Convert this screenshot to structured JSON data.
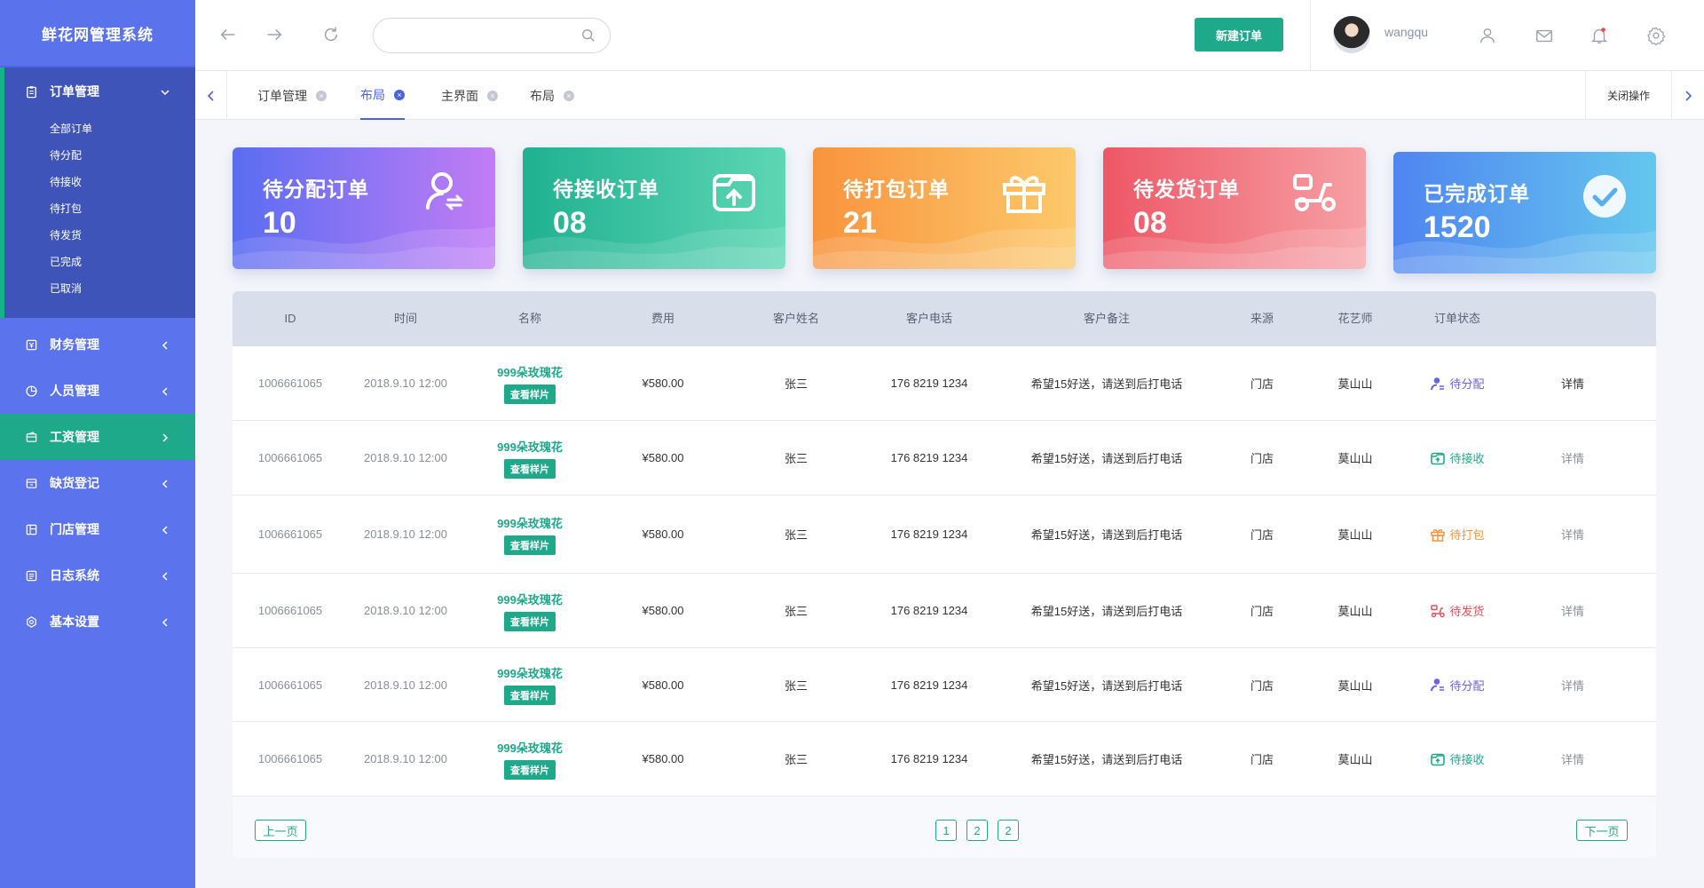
{
  "app": {
    "title": "鲜花网管理系统"
  },
  "sidebar": {
    "order_group": {
      "label": "订单管理",
      "items": [
        "全部订单",
        "待分配",
        "待接收",
        "待打包",
        "待发货",
        "已完成",
        "已取消"
      ]
    },
    "menus": [
      {
        "label": "财务管理",
        "icon": "finance-icon"
      },
      {
        "label": "人员管理",
        "icon": "pie-chart-icon"
      },
      {
        "label": "工资管理",
        "icon": "wallet-icon",
        "active": true
      },
      {
        "label": "缺货登记",
        "icon": "box-icon"
      },
      {
        "label": "门店管理",
        "icon": "store-icon"
      },
      {
        "label": "日志系统",
        "icon": "log-icon"
      },
      {
        "label": "基本设置",
        "icon": "settings-icon"
      }
    ]
  },
  "topbar": {
    "search_placeholder": "",
    "new_order_label": "新建订单",
    "username": "wangqu"
  },
  "tabs": {
    "items": [
      {
        "label": "订单管理",
        "active": false
      },
      {
        "label": "布局",
        "active": true
      },
      {
        "label": "主界面",
        "active": false
      },
      {
        "label": "布局",
        "active": false
      }
    ],
    "close_ops_label": "关闭操作"
  },
  "cards": [
    {
      "label": "待分配订单",
      "value": "10",
      "icon": "user-assign-icon"
    },
    {
      "label": "待接收订单",
      "value": "08",
      "icon": "inbox-upload-icon"
    },
    {
      "label": "待打包订单",
      "value": "21",
      "icon": "gift-icon"
    },
    {
      "label": "待发货订单",
      "value": "08",
      "icon": "scooter-icon"
    },
    {
      "label": "已完成订单",
      "value": "1520",
      "icon": "check-circle-icon"
    }
  ],
  "table": {
    "headers": [
      "ID",
      "时间",
      "名称",
      "费用",
      "客户姓名",
      "客户电话",
      "客户备注",
      "来源",
      "花艺师",
      "订单状态"
    ],
    "view_sample_label": "查看样片",
    "detail_label": "详情",
    "rows": [
      {
        "id": "1006661065",
        "time": "2018.9.10 12:00",
        "name": "999朵玫瑰花",
        "fee": "¥580.00",
        "customer": "张三",
        "phone": "176 8219 1234",
        "note": "希望15好送，请送到后打电话",
        "source": "门店",
        "florist": "莫山山",
        "status": "待分配",
        "status_type": "purple"
      },
      {
        "id": "1006661065",
        "time": "2018.9.10 12:00",
        "name": "999朵玫瑰花",
        "fee": "¥580.00",
        "customer": "张三",
        "phone": "176 8219 1234",
        "note": "希望15好送，请送到后打电话",
        "source": "门店",
        "florist": "莫山山",
        "status": "待接收",
        "status_type": "green"
      },
      {
        "id": "1006661065",
        "time": "2018.9.10 12:00",
        "name": "999朵玫瑰花",
        "fee": "¥580.00",
        "customer": "张三",
        "phone": "176 8219 1234",
        "note": "希望15好送，请送到后打电话",
        "source": "门店",
        "florist": "莫山山",
        "status": "待打包",
        "status_type": "orange"
      },
      {
        "id": "1006661065",
        "time": "2018.9.10 12:00",
        "name": "999朵玫瑰花",
        "fee": "¥580.00",
        "customer": "张三",
        "phone": "176 8219 1234",
        "note": "希望15好送，请送到后打电话",
        "source": "门店",
        "florist": "莫山山",
        "status": "待发货",
        "status_type": "red"
      },
      {
        "id": "1006661065",
        "time": "2018.9.10 12:00",
        "name": "999朵玫瑰花",
        "fee": "¥580.00",
        "customer": "张三",
        "phone": "176 8219 1234",
        "note": "希望15好送，请送到后打电话",
        "source": "门店",
        "florist": "莫山山",
        "status": "待分配",
        "status_type": "purple"
      },
      {
        "id": "1006661065",
        "time": "2018.9.10 12:00",
        "name": "999朵玫瑰花",
        "fee": "¥580.00",
        "customer": "张三",
        "phone": "176 8219 1234",
        "note": "希望15好送，请送到后打电话",
        "source": "门店",
        "florist": "莫山山",
        "status": "待接收",
        "status_type": "green"
      }
    ]
  },
  "pager": {
    "prev_label": "上一页",
    "next_label": "下一页",
    "pages": [
      "1",
      "2",
      "2"
    ]
  },
  "colors": {
    "sidebar_bg": "#5b73ec",
    "accent_green": "#1fa98b",
    "accent_blue": "#4a63e0"
  }
}
